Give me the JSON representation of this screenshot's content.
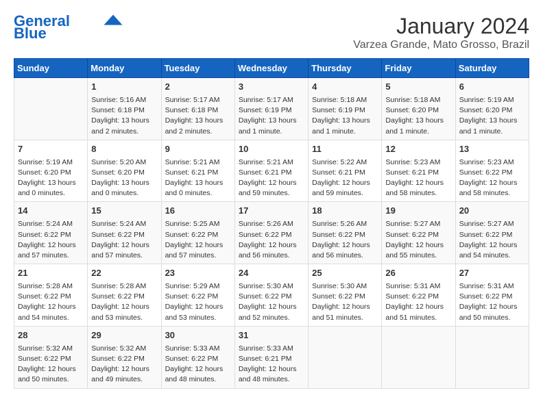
{
  "logo": {
    "line1": "General",
    "line2": "Blue"
  },
  "title": "January 2024",
  "subtitle": "Varzea Grande, Mato Grosso, Brazil",
  "weekdays": [
    "Sunday",
    "Monday",
    "Tuesday",
    "Wednesday",
    "Thursday",
    "Friday",
    "Saturday"
  ],
  "weeks": [
    [
      {
        "day": "",
        "info": ""
      },
      {
        "day": "1",
        "info": "Sunrise: 5:16 AM\nSunset: 6:18 PM\nDaylight: 13 hours\nand 2 minutes."
      },
      {
        "day": "2",
        "info": "Sunrise: 5:17 AM\nSunset: 6:18 PM\nDaylight: 13 hours\nand 2 minutes."
      },
      {
        "day": "3",
        "info": "Sunrise: 5:17 AM\nSunset: 6:19 PM\nDaylight: 13 hours\nand 1 minute."
      },
      {
        "day": "4",
        "info": "Sunrise: 5:18 AM\nSunset: 6:19 PM\nDaylight: 13 hours\nand 1 minute."
      },
      {
        "day": "5",
        "info": "Sunrise: 5:18 AM\nSunset: 6:20 PM\nDaylight: 13 hours\nand 1 minute."
      },
      {
        "day": "6",
        "info": "Sunrise: 5:19 AM\nSunset: 6:20 PM\nDaylight: 13 hours\nand 1 minute."
      }
    ],
    [
      {
        "day": "7",
        "info": "Sunrise: 5:19 AM\nSunset: 6:20 PM\nDaylight: 13 hours\nand 0 minutes."
      },
      {
        "day": "8",
        "info": "Sunrise: 5:20 AM\nSunset: 6:20 PM\nDaylight: 13 hours\nand 0 minutes."
      },
      {
        "day": "9",
        "info": "Sunrise: 5:21 AM\nSunset: 6:21 PM\nDaylight: 13 hours\nand 0 minutes."
      },
      {
        "day": "10",
        "info": "Sunrise: 5:21 AM\nSunset: 6:21 PM\nDaylight: 12 hours\nand 59 minutes."
      },
      {
        "day": "11",
        "info": "Sunrise: 5:22 AM\nSunset: 6:21 PM\nDaylight: 12 hours\nand 59 minutes."
      },
      {
        "day": "12",
        "info": "Sunrise: 5:23 AM\nSunset: 6:21 PM\nDaylight: 12 hours\nand 58 minutes."
      },
      {
        "day": "13",
        "info": "Sunrise: 5:23 AM\nSunset: 6:22 PM\nDaylight: 12 hours\nand 58 minutes."
      }
    ],
    [
      {
        "day": "14",
        "info": "Sunrise: 5:24 AM\nSunset: 6:22 PM\nDaylight: 12 hours\nand 57 minutes."
      },
      {
        "day": "15",
        "info": "Sunrise: 5:24 AM\nSunset: 6:22 PM\nDaylight: 12 hours\nand 57 minutes."
      },
      {
        "day": "16",
        "info": "Sunrise: 5:25 AM\nSunset: 6:22 PM\nDaylight: 12 hours\nand 57 minutes."
      },
      {
        "day": "17",
        "info": "Sunrise: 5:26 AM\nSunset: 6:22 PM\nDaylight: 12 hours\nand 56 minutes."
      },
      {
        "day": "18",
        "info": "Sunrise: 5:26 AM\nSunset: 6:22 PM\nDaylight: 12 hours\nand 56 minutes."
      },
      {
        "day": "19",
        "info": "Sunrise: 5:27 AM\nSunset: 6:22 PM\nDaylight: 12 hours\nand 55 minutes."
      },
      {
        "day": "20",
        "info": "Sunrise: 5:27 AM\nSunset: 6:22 PM\nDaylight: 12 hours\nand 54 minutes."
      }
    ],
    [
      {
        "day": "21",
        "info": "Sunrise: 5:28 AM\nSunset: 6:22 PM\nDaylight: 12 hours\nand 54 minutes."
      },
      {
        "day": "22",
        "info": "Sunrise: 5:28 AM\nSunset: 6:22 PM\nDaylight: 12 hours\nand 53 minutes."
      },
      {
        "day": "23",
        "info": "Sunrise: 5:29 AM\nSunset: 6:22 PM\nDaylight: 12 hours\nand 53 minutes."
      },
      {
        "day": "24",
        "info": "Sunrise: 5:30 AM\nSunset: 6:22 PM\nDaylight: 12 hours\nand 52 minutes."
      },
      {
        "day": "25",
        "info": "Sunrise: 5:30 AM\nSunset: 6:22 PM\nDaylight: 12 hours\nand 51 minutes."
      },
      {
        "day": "26",
        "info": "Sunrise: 5:31 AM\nSunset: 6:22 PM\nDaylight: 12 hours\nand 51 minutes."
      },
      {
        "day": "27",
        "info": "Sunrise: 5:31 AM\nSunset: 6:22 PM\nDaylight: 12 hours\nand 50 minutes."
      }
    ],
    [
      {
        "day": "28",
        "info": "Sunrise: 5:32 AM\nSunset: 6:22 PM\nDaylight: 12 hours\nand 50 minutes."
      },
      {
        "day": "29",
        "info": "Sunrise: 5:32 AM\nSunset: 6:22 PM\nDaylight: 12 hours\nand 49 minutes."
      },
      {
        "day": "30",
        "info": "Sunrise: 5:33 AM\nSunset: 6:22 PM\nDaylight: 12 hours\nand 48 minutes."
      },
      {
        "day": "31",
        "info": "Sunrise: 5:33 AM\nSunset: 6:21 PM\nDaylight: 12 hours\nand 48 minutes."
      },
      {
        "day": "",
        "info": ""
      },
      {
        "day": "",
        "info": ""
      },
      {
        "day": "",
        "info": ""
      }
    ]
  ]
}
